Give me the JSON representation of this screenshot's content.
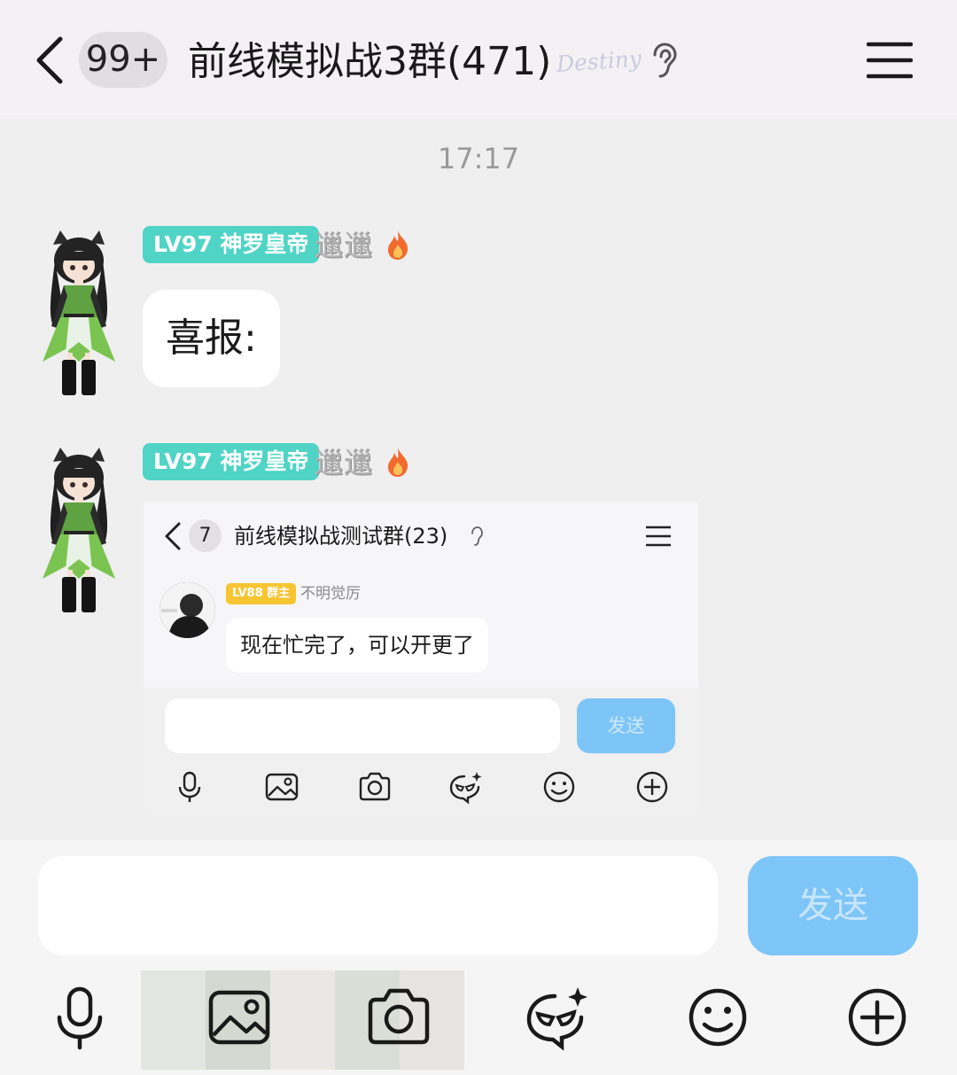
{
  "header": {
    "unread_count": "99+",
    "group_title": "前线模拟战3群(471)",
    "logo_text": "Destiny"
  },
  "chat": {
    "timestamp": "17:17",
    "messages": [
      {
        "level": "LV97 神罗皇帝",
        "nickname": "邋邋",
        "icon": "fire-icon",
        "text": "喜报:"
      },
      {
        "level": "LV97 神罗皇帝",
        "nickname": "邋邋",
        "icon": "fire-icon",
        "embedded_screenshot": {
          "unread_count": "7",
          "group_title": "前线模拟战测试群(23)",
          "sender_level": "LV88 群主",
          "sender_name": "不明觉厉",
          "text": "现在忙完了，可以开更了",
          "send_label": "发送"
        }
      }
    ]
  },
  "input_bar": {
    "send_label": "发送",
    "tools": [
      "microphone-icon",
      "image-icon",
      "camera-icon",
      "sticker-icon",
      "emoji-icon",
      "plus-icon"
    ]
  },
  "colors": {
    "level_badge": "#4fd4c6",
    "owner_badge": "#f7c532",
    "send_button": "#7ec5f8",
    "header_bg": "#f4f1f4",
    "chat_bg": "#efefef"
  }
}
